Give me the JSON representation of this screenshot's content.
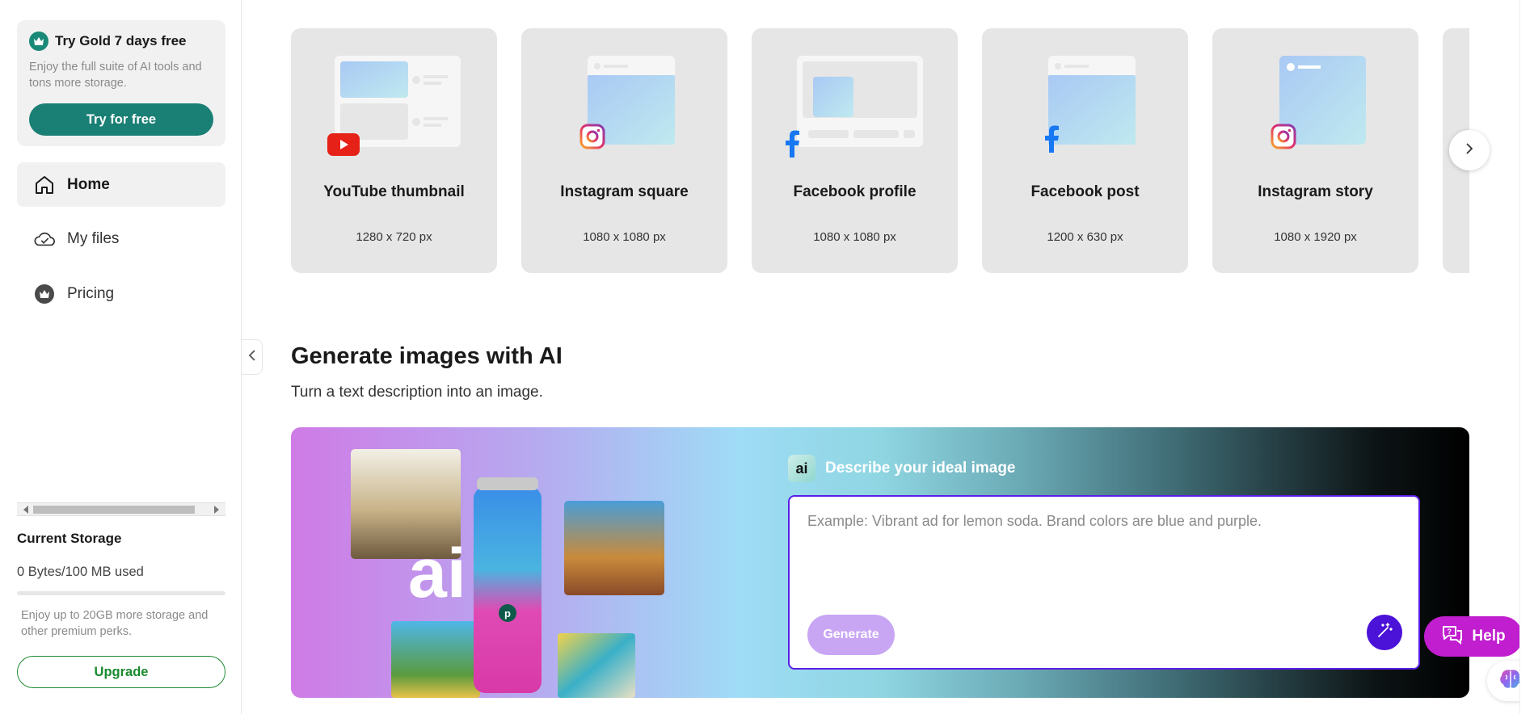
{
  "sidebar": {
    "promo": {
      "title": "Try Gold 7 days free",
      "text": "Enjoy the full suite of AI tools and tons more storage.",
      "button": "Try for free"
    },
    "nav": [
      {
        "label": "Home",
        "icon": "home-icon",
        "active": true
      },
      {
        "label": "My files",
        "icon": "cloud-check-icon",
        "active": false
      },
      {
        "label": "Pricing",
        "icon": "crown-icon",
        "active": false
      }
    ],
    "storage": {
      "title": "Current Storage",
      "used": "0 Bytes/100 MB used",
      "used_fraction": 0,
      "note": "Enjoy up to 20GB more storage and other premium perks.",
      "upgrade": "Upgrade"
    }
  },
  "templates": [
    {
      "title": "YouTube thumbnail",
      "size": "1280 x 720 px",
      "platform": "youtube-icon"
    },
    {
      "title": "Instagram square",
      "size": "1080 x 1080 px",
      "platform": "instagram-icon"
    },
    {
      "title": "Facebook profile",
      "size": "1080 x 1080 px",
      "platform": "facebook-icon"
    },
    {
      "title": "Facebook post",
      "size": "1200 x 630 px",
      "platform": "facebook-icon"
    },
    {
      "title": "Instagram story",
      "size": "1080 x 1920 px",
      "platform": "instagram-icon"
    }
  ],
  "ai": {
    "title": "Generate images with AI",
    "subtitle": "Turn a text description into an image.",
    "chip": "ai",
    "label": "Describe your ideal image",
    "placeholder": "Example: Vibrant ad for lemon soda. Brand colors are blue and purple.",
    "generate": "Generate"
  },
  "help": {
    "label": "Help"
  },
  "colors": {
    "accent_teal": "#1a7f74",
    "upgrade_green": "#1a8a2e",
    "prompt_border": "#5a1ee8",
    "help_magenta": "#c01ecf",
    "generate_disabled": "#c9a6f4"
  }
}
